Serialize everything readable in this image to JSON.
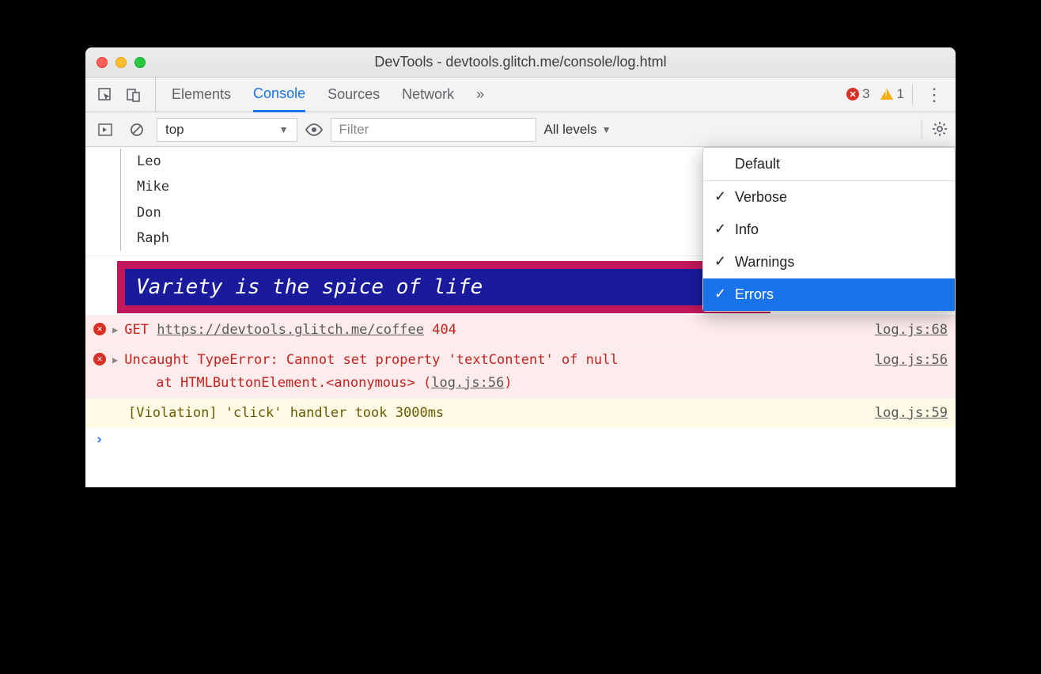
{
  "window": {
    "title": "DevTools - devtools.glitch.me/console/log.html"
  },
  "tabs": {
    "elements": "Elements",
    "console": "Console",
    "sources": "Sources",
    "network": "Network"
  },
  "badges": {
    "error_count": "3",
    "warn_count": "1"
  },
  "toolbar": {
    "context": "top",
    "filter_placeholder": "Filter",
    "levels_label": "All levels"
  },
  "levels_menu": {
    "default": "Default",
    "verbose": "Verbose",
    "info": "Info",
    "warnings": "Warnings",
    "errors": "Errors"
  },
  "tree": [
    "Leo",
    "Mike",
    "Don",
    "Raph"
  ],
  "styled": "Variety is the spice of life",
  "errors": {
    "e1": {
      "method": "GET",
      "url": "https://devtools.glitch.me/coffee",
      "code": "404",
      "source": "log.js:68"
    },
    "e2": {
      "msg": "Uncaught TypeError: Cannot set property 'textContent' of null",
      "stack_prefix": "at HTMLButtonElement.<anonymous> (",
      "stack_link": "log.js:56",
      "stack_suffix": ")",
      "source": "log.js:56"
    }
  },
  "violation": {
    "msg": "[Violation] 'click' handler took 3000ms",
    "source": "log.js:59"
  }
}
